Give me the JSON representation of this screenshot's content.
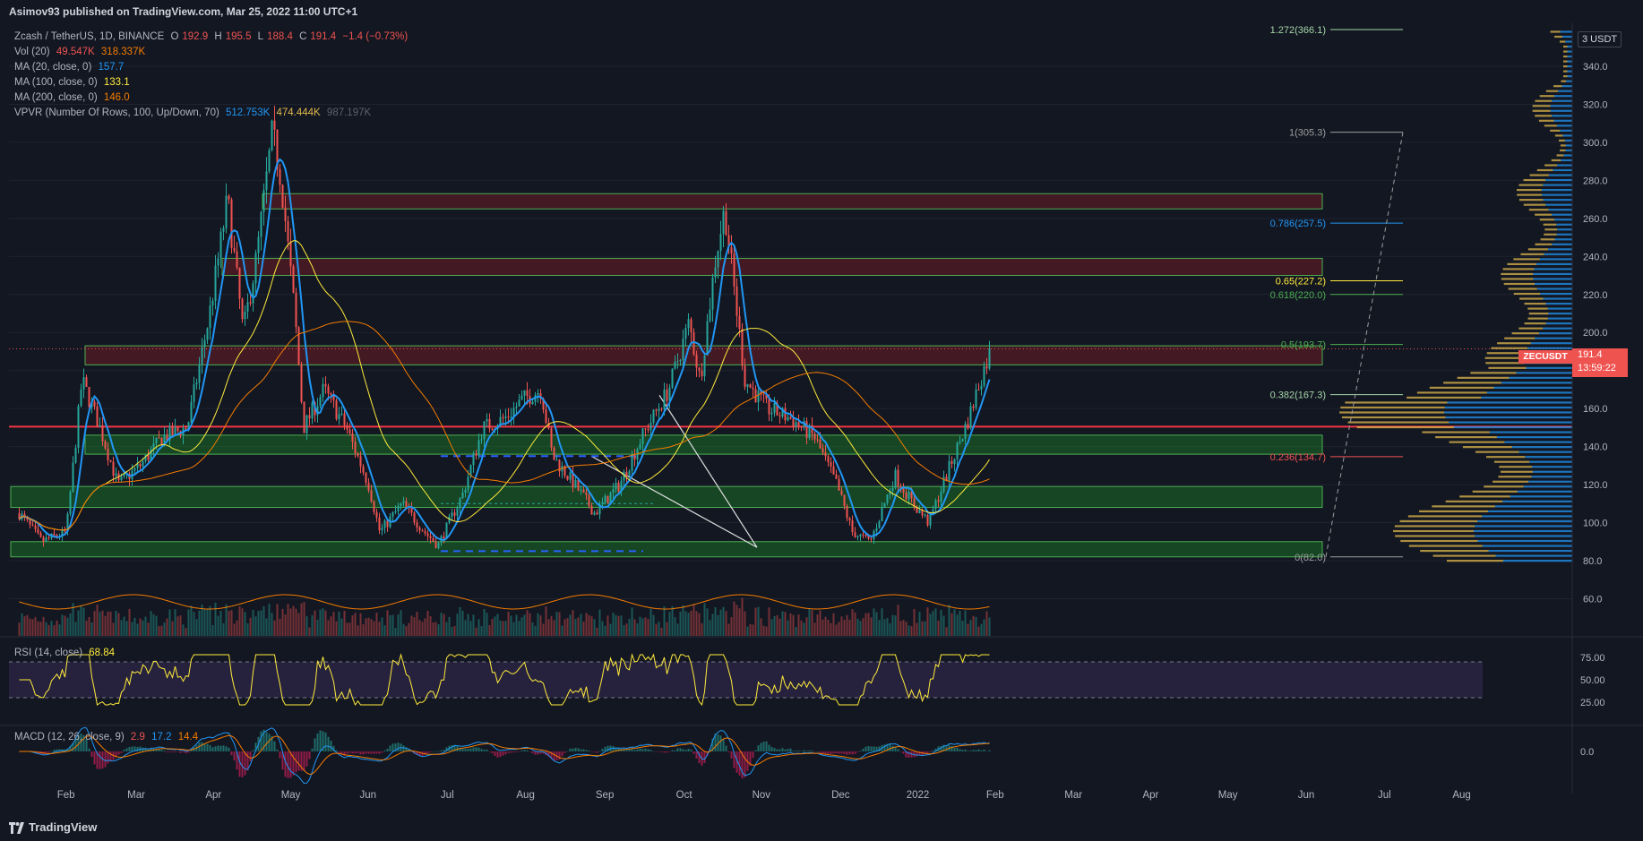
{
  "header": {
    "published": "Asimov93 published on TradingView.com, Mar 25, 2022 11:00 UTC+1"
  },
  "legend": {
    "symbol": "Zcash / TetherUS, 1D, BINANCE",
    "ohlc": {
      "o_label": "O",
      "o": "192.9",
      "h_label": "H",
      "h": "195.5",
      "l_label": "L",
      "l": "188.4",
      "c_label": "C",
      "c": "191.4",
      "chg": "−1.4 (−0.73%)"
    },
    "vol": {
      "label": "Vol (20)",
      "v1": "49.547K",
      "v2": "318.337K"
    },
    "ma20": {
      "label": "MA (20, close, 0)",
      "value": "157.7"
    },
    "ma100": {
      "label": "MA (100, close, 0)",
      "value": "133.1"
    },
    "ma200": {
      "label": "MA (200, close, 0)",
      "value": "146.0"
    },
    "vpvr": {
      "label": "VPVR (Number Of Rows, 100, Up/Down, 70)",
      "v1": "512.753K",
      "v2": "474.444K",
      "v3": "987.197K"
    }
  },
  "rsi_legend": {
    "label": "RSI (14, close)",
    "value": "68.84"
  },
  "macd_legend": {
    "label": "MACD (12, 26, close, 9)",
    "v1": "2.9",
    "v2": "17.2",
    "v3": "14.4"
  },
  "price_tag": {
    "symbol": "ZECUSDT",
    "price": "191.4",
    "countdown": "13:59:22"
  },
  "currency": "3 USDT",
  "footer": {
    "brand": "TradingView"
  },
  "colors": {
    "up": "#26a69a",
    "down": "#ef5350",
    "ma20": "#2196f3",
    "ma100": "#ffeb3b",
    "ma200": "#f57c00",
    "rsi": "#ffeb3b",
    "bg": "#131722"
  },
  "chart_data": {
    "type": "candlestick",
    "symbol": "Zcash / TetherUS",
    "interval": "1D",
    "exchange": "BINANCE",
    "y_axis": {
      "ticks": [
        60,
        80,
        100,
        120,
        140,
        160,
        180,
        200,
        220,
        240,
        260,
        280,
        300,
        320,
        340
      ]
    },
    "x_axis": {
      "labels": [
        "Feb",
        "Mar",
        "Apr",
        "May",
        "Jun",
        "Jul",
        "Aug",
        "Sep",
        "Oct",
        "Nov",
        "Dec",
        "2022",
        "Feb",
        "Mar",
        "Apr",
        "May",
        "Jun",
        "Jul",
        "Aug"
      ]
    },
    "price_path": [
      [
        "2021-01-15",
        105
      ],
      [
        "2021-01-25",
        90
      ],
      [
        "2021-02-05",
        95
      ],
      [
        "2021-02-12",
        175
      ],
      [
        "2021-02-20",
        150
      ],
      [
        "2021-02-28",
        120
      ],
      [
        "2021-03-10",
        130
      ],
      [
        "2021-03-20",
        145
      ],
      [
        "2021-03-31",
        150
      ],
      [
        "2021-04-10",
        210
      ],
      [
        "2021-04-18",
        270
      ],
      [
        "2021-04-25",
        200
      ],
      [
        "2021-05-01",
        240
      ],
      [
        "2021-05-08",
        305
      ],
      [
        "2021-05-12",
        280
      ],
      [
        "2021-05-18",
        210
      ],
      [
        "2021-05-22",
        150
      ],
      [
        "2021-05-31",
        170
      ],
      [
        "2021-06-10",
        150
      ],
      [
        "2021-06-20",
        120
      ],
      [
        "2021-06-25",
        95
      ],
      [
        "2021-07-05",
        110
      ],
      [
        "2021-07-15",
        95
      ],
      [
        "2021-07-21",
        88
      ],
      [
        "2021-08-01",
        115
      ],
      [
        "2021-08-10",
        150
      ],
      [
        "2021-08-20",
        155
      ],
      [
        "2021-08-28",
        165
      ],
      [
        "2021-09-05",
        170
      ],
      [
        "2021-09-10",
        135
      ],
      [
        "2021-09-20",
        120
      ],
      [
        "2021-09-29",
        105
      ],
      [
        "2021-10-10",
        120
      ],
      [
        "2021-10-20",
        145
      ],
      [
        "2021-11-01",
        170
      ],
      [
        "2021-11-10",
        205
      ],
      [
        "2021-11-15",
        175
      ],
      [
        "2021-11-22",
        240
      ],
      [
        "2021-11-26",
        265
      ],
      [
        "2021-12-01",
        215
      ],
      [
        "2021-12-05",
        175
      ],
      [
        "2021-12-15",
        160
      ],
      [
        "2021-12-25",
        155
      ],
      [
        "2022-01-05",
        145
      ],
      [
        "2022-01-15",
        120
      ],
      [
        "2022-01-22",
        95
      ],
      [
        "2022-01-30",
        90
      ],
      [
        "2022-02-10",
        125
      ],
      [
        "2022-02-18",
        110
      ],
      [
        "2022-02-25",
        100
      ],
      [
        "2022-03-05",
        125
      ],
      [
        "2022-03-10",
        140
      ],
      [
        "2022-03-15",
        155
      ],
      [
        "2022-03-20",
        175
      ],
      [
        "2022-03-25",
        191.4
      ]
    ],
    "moving_averages": [
      {
        "name": "MA (20, close, 0)",
        "last": 157.7,
        "color": "#2196f3"
      },
      {
        "name": "MA (100, close, 0)",
        "last": 133.1,
        "color": "#ffeb3b"
      },
      {
        "name": "MA (200, close, 0)",
        "last": 146.0,
        "color": "#f57c00"
      }
    ],
    "fib_levels": [
      {
        "label": "1.272(366.1)",
        "value": 366.1,
        "color": "#a5d6a7"
      },
      {
        "label": "1(305.3)",
        "value": 305.3,
        "color": "#9e9e9e"
      },
      {
        "label": "0.786(257.5)",
        "value": 257.5,
        "color": "#2196f3"
      },
      {
        "label": "0.65(227.2)",
        "value": 227.2,
        "color": "#ffeb3b"
      },
      {
        "label": "0.618(220.0)",
        "value": 220.0,
        "color": "#4caf50"
      },
      {
        "label": "0.5(193.7)",
        "value": 193.7,
        "color": "#4caf50"
      },
      {
        "label": "0.382(167.3)",
        "value": 167.3,
        "color": "#a5d6a7"
      },
      {
        "label": "0.236(134.7)",
        "value": 134.7,
        "color": "#ef5350"
      },
      {
        "label": "0(82.0)",
        "value": 82.0,
        "color": "#9e9e9e"
      }
    ],
    "zones": [
      {
        "kind": "resistance",
        "low": 265,
        "high": 273
      },
      {
        "kind": "resistance",
        "low": 230,
        "high": 239
      },
      {
        "kind": "resistance",
        "low": 183,
        "high": 193
      },
      {
        "kind": "support",
        "low": 136,
        "high": 146
      },
      {
        "kind": "support",
        "low": 108,
        "high": 119
      },
      {
        "kind": "support",
        "low": 82,
        "high": 90
      }
    ],
    "horizontal_line": 150.5,
    "rsi": {
      "ticks": [
        75,
        50,
        25
      ],
      "upper": 70,
      "lower": 30,
      "last": 68.84
    },
    "macd": {
      "ticks": [
        "0.0"
      ],
      "macd": 17.2,
      "signal": 14.4,
      "hist": 2.9
    }
  }
}
